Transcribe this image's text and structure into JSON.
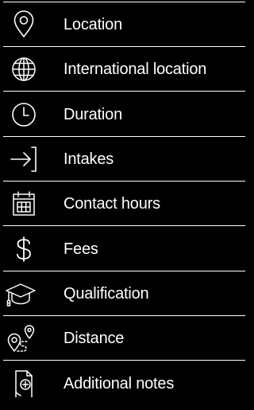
{
  "theme": {
    "background": "#000000",
    "foreground": "#ffffff"
  },
  "items": [
    {
      "label": "Location",
      "icon": "map-pin-icon"
    },
    {
      "label": "International location",
      "icon": "globe-icon"
    },
    {
      "label": "Duration",
      "icon": "clock-icon"
    },
    {
      "label": "Intakes",
      "icon": "arrow-in-icon"
    },
    {
      "label": "Contact hours",
      "icon": "calendar-icon"
    },
    {
      "label": "Fees",
      "icon": "dollar-icon"
    },
    {
      "label": "Qualification",
      "icon": "graduation-cap-icon"
    },
    {
      "label": "Distance",
      "icon": "distance-pins-icon"
    },
    {
      "label": "Additional notes",
      "icon": "add-note-icon"
    }
  ]
}
